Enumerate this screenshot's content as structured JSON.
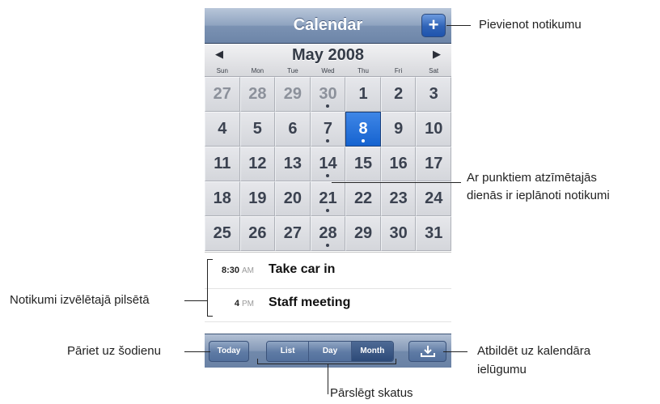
{
  "navbar": {
    "title": "Calendar",
    "add_label": "+"
  },
  "month": {
    "prev": "◀",
    "next": "▶",
    "title": "May 2008",
    "weekdays": [
      "Sun",
      "Mon",
      "Tue",
      "Wed",
      "Thu",
      "Fri",
      "Sat"
    ]
  },
  "days": [
    {
      "n": "27",
      "muted": true,
      "dot": false
    },
    {
      "n": "28",
      "muted": true,
      "dot": false
    },
    {
      "n": "29",
      "muted": true,
      "dot": false
    },
    {
      "n": "30",
      "muted": true,
      "dot": true
    },
    {
      "n": "1",
      "muted": false,
      "dot": false
    },
    {
      "n": "2",
      "muted": false,
      "dot": false
    },
    {
      "n": "3",
      "muted": false,
      "dot": false
    },
    {
      "n": "4",
      "muted": false,
      "dot": false
    },
    {
      "n": "5",
      "muted": false,
      "dot": false
    },
    {
      "n": "6",
      "muted": false,
      "dot": false
    },
    {
      "n": "7",
      "muted": false,
      "dot": true
    },
    {
      "n": "8",
      "muted": false,
      "dot": true,
      "selected": true
    },
    {
      "n": "9",
      "muted": false,
      "dot": false
    },
    {
      "n": "10",
      "muted": false,
      "dot": false
    },
    {
      "n": "11",
      "muted": false,
      "dot": false
    },
    {
      "n": "12",
      "muted": false,
      "dot": false
    },
    {
      "n": "13",
      "muted": false,
      "dot": false
    },
    {
      "n": "14",
      "muted": false,
      "dot": true
    },
    {
      "n": "15",
      "muted": false,
      "dot": false
    },
    {
      "n": "16",
      "muted": false,
      "dot": false
    },
    {
      "n": "17",
      "muted": false,
      "dot": false
    },
    {
      "n": "18",
      "muted": false,
      "dot": false
    },
    {
      "n": "19",
      "muted": false,
      "dot": false
    },
    {
      "n": "20",
      "muted": false,
      "dot": false
    },
    {
      "n": "21",
      "muted": false,
      "dot": true
    },
    {
      "n": "22",
      "muted": false,
      "dot": false
    },
    {
      "n": "23",
      "muted": false,
      "dot": false
    },
    {
      "n": "24",
      "muted": false,
      "dot": false
    },
    {
      "n": "25",
      "muted": false,
      "dot": false
    },
    {
      "n": "26",
      "muted": false,
      "dot": false
    },
    {
      "n": "27",
      "muted": false,
      "dot": false
    },
    {
      "n": "28",
      "muted": false,
      "dot": true
    },
    {
      "n": "29",
      "muted": false,
      "dot": false
    },
    {
      "n": "30",
      "muted": false,
      "dot": false
    },
    {
      "n": "31",
      "muted": false,
      "dot": false
    }
  ],
  "events": [
    {
      "time": "8:30",
      "ampm": "AM",
      "title": "Take car in"
    },
    {
      "time": "4",
      "ampm": "PM",
      "title": "Staff meeting"
    }
  ],
  "toolbar": {
    "today": "Today",
    "views": [
      "List",
      "Day",
      "Month"
    ],
    "active_view": "Month",
    "invite_icon": "download-tray-icon"
  },
  "annotations": {
    "add_event": "Pievienot notikumu",
    "dots_line1": "Ar punktiem atzīmētajās",
    "dots_line2": "dienās ir ieplānoti notikumi",
    "events_city": "Notikumi izvēlētajā pilsētā",
    "go_today": "Pāriet uz šodienu",
    "invite_line1": "Atbildēt uz kalendāra",
    "invite_line2": "ielūgumu",
    "switch_views": "Pārslēgt skatus"
  },
  "colors": {
    "selected": "#1563d0",
    "navbar": "#7b92b3",
    "day_text": "#3b4250",
    "muted_text": "#8c919b"
  }
}
